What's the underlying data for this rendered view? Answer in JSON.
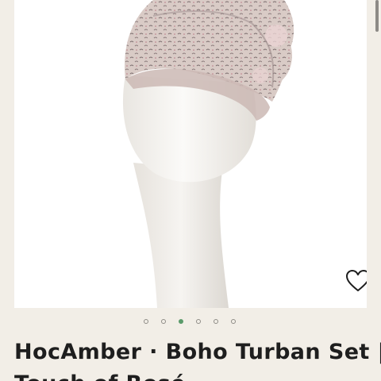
{
  "product": {
    "title": "HocAmber · Boho Turban Set | Touch of Rosé",
    "image_alt": "Boho patterned turban on a white mannequin head",
    "wishlist_icon": "heart-icon"
  },
  "carousel": {
    "dot_count": 6,
    "active_index": 2
  },
  "colors": {
    "page_background": "#f2eee7",
    "image_background": "#ffffff",
    "active_dot": "#5a9a6a",
    "text": "#1e1e1e"
  }
}
